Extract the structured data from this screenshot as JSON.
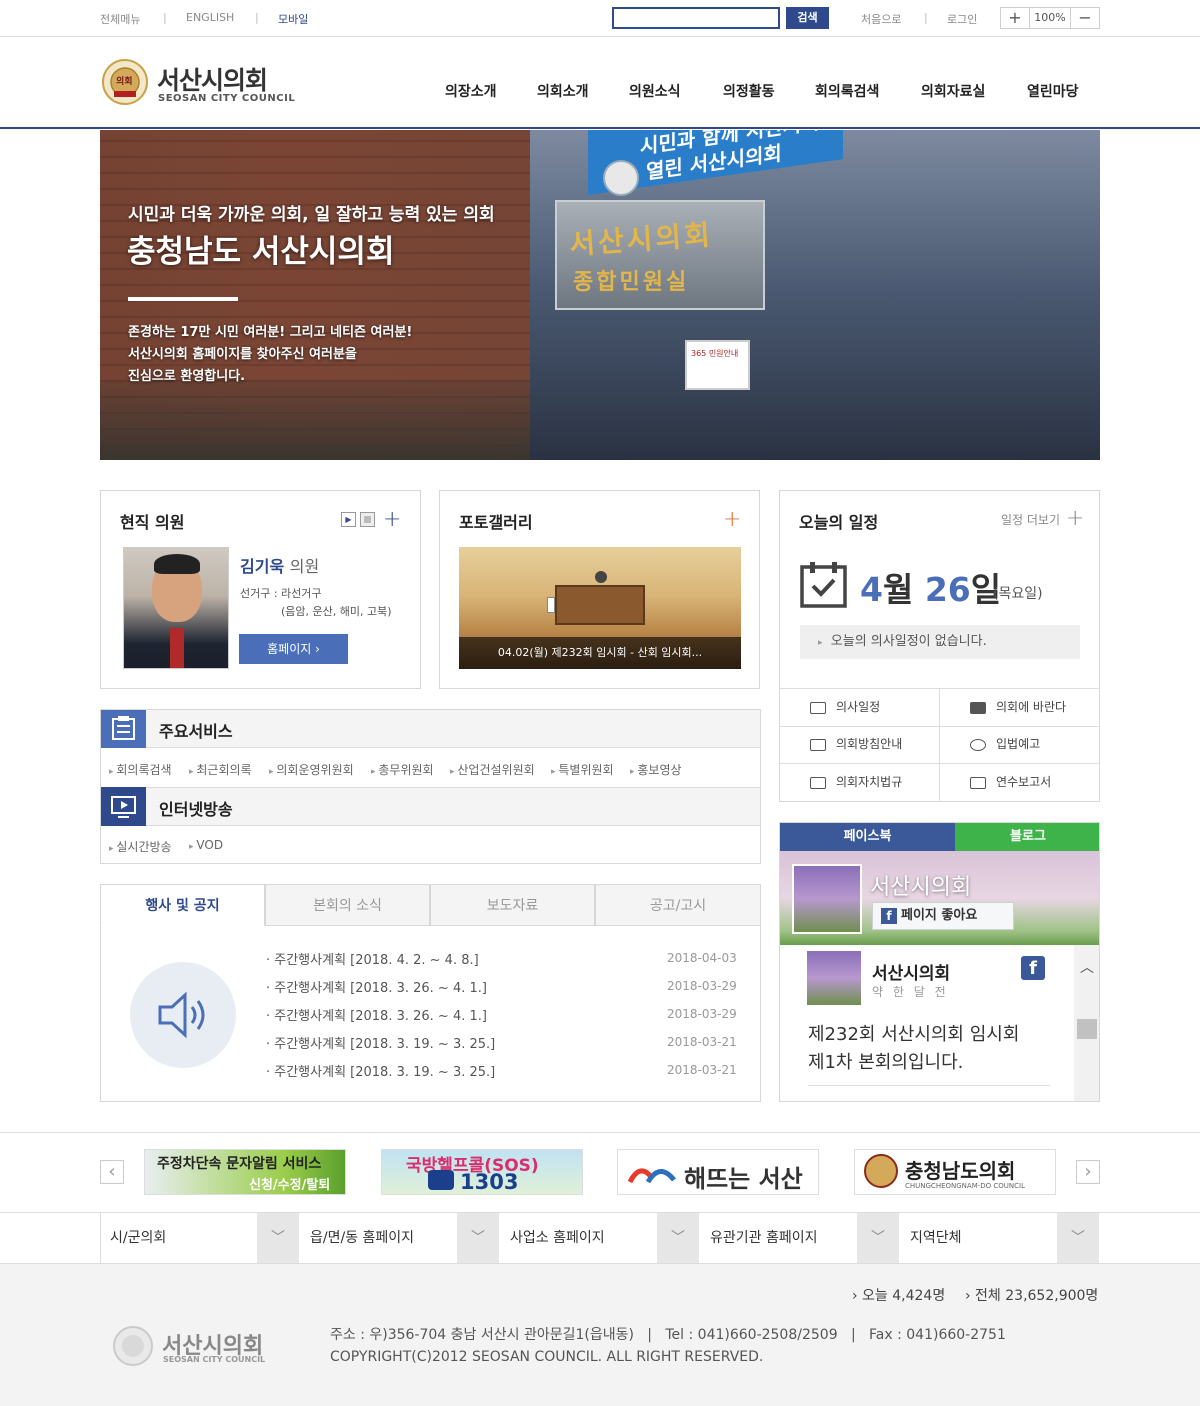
{
  "topbar": {
    "all_menu": "전체메뉴",
    "english": "ENGLISH",
    "mobile": "모바일",
    "search_placeholder": "",
    "search_button": "검색",
    "first": "처음으로",
    "login": "로그인",
    "zoom_in": "+",
    "zoom_level": "100%",
    "zoom_out": "−"
  },
  "brand": {
    "name_ko": "서산시의회",
    "name_en": "SEOSAN CITY COUNCIL",
    "seal_text": "의회"
  },
  "gnb": [
    "의장소개",
    "의회소개",
    "의원소식",
    "의정활동",
    "회의록검색",
    "의회자료실",
    "열린마당"
  ],
  "hero": {
    "sub": "시민과 더욱 가까운 의회, 일 잘하고 능력 있는 의회",
    "title": "충청남도 서산시의회",
    "line1": "존경하는 17만 시민 여러분! 그리고 네티즌 여러분!",
    "line2": "서산시의회 홈페이지를 찾아주신 여러분을",
    "line3": "진심으로 환영합니다.",
    "sign1": "시민과 함께 서산시의회",
    "sign2": "열린 서산시의회",
    "building_sign1": "서산시의회",
    "building_sign2": "종합민원실",
    "door_sign": "365 민원안내"
  },
  "members": {
    "title": "현직 의원",
    "name": "김기욱",
    "role": "의원",
    "district": "선거구 : 라선거구",
    "district_detail": "(음암, 운산, 해미, 고북)",
    "homepage": "홈페이지  ›"
  },
  "gallery": {
    "title": "포토갤러리",
    "caption": "04.02(월) 제232회 임시회 - 산회 임시회..."
  },
  "schedule": {
    "title": "오늘의 일정",
    "more": "일정 더보기",
    "month": "4",
    "month_unit": "월",
    "day": "26",
    "day_unit": "일",
    "weekday": "(목요일)",
    "empty": "오늘의 의사일정이 없습니다.",
    "quick": [
      "의사일정",
      "의회에 바란다",
      "의회방침안내",
      "입법예고",
      "의회자치법규",
      "연수보고서"
    ]
  },
  "services": {
    "title": "주요서비스",
    "items": [
      "회의록검색",
      "최근회의록",
      "의회운영위원회",
      "총무위원회",
      "산업건설위원회",
      "특별위원회",
      "홍보영상"
    ]
  },
  "broadcast": {
    "title": "인터넷방송",
    "items": [
      "실시간방송",
      "VOD"
    ]
  },
  "notices": {
    "tabs": [
      "행사 및 공지",
      "본회의 소식",
      "보도자료",
      "공고/고시"
    ],
    "rows": [
      {
        "title": "· 주간행사계획 [2018. 4. 2. ~ 4. 8.]",
        "date": "2018-04-03"
      },
      {
        "title": "· 주간행사계획 [2018. 3. 26. ~ 4. 1.]",
        "date": "2018-03-29"
      },
      {
        "title": "· 주간행사계획 [2018. 3. 26. ~ 4. 1.]",
        "date": "2018-03-29"
      },
      {
        "title": "· 주간행사계획 [2018. 3. 19. ~ 3. 25.]",
        "date": "2018-03-21"
      },
      {
        "title": "· 주간행사계획 [2018. 3. 19. ~ 3. 25.]",
        "date": "2018-03-21"
      }
    ]
  },
  "sns": {
    "facebook_tab": "페이스북",
    "blog_tab": "블로그",
    "page_name": "서산시의회",
    "like_button": "페이지 좋아요",
    "post_author": "서산시의회",
    "post_time": "약 한 달 전",
    "post_text1": "제232회 서산시의회 임시회",
    "post_text2": "제1차 본회의입니다.",
    "fb_glyph": "f"
  },
  "banners": {
    "prev": "‹",
    "next": "›",
    "b1_line1": "주정차단속 문자알림 서비스",
    "b1_line2": "신청/수정/탈퇴",
    "b2_line1": "국방헬프콜(SOS)",
    "b2_line2": "1303",
    "b3": "해뜨는 서산",
    "b4_ko": "충청남도의회",
    "b4_en": "CHUNGCHEONGNAM-DO COUNCIL"
  },
  "family": [
    "시/군의회",
    "읍/면/동 홈페이지",
    "사업소 홈페이지",
    "유관기관 홈페이지",
    "지역단체"
  ],
  "footer": {
    "today": "› 오늘 4,424명",
    "total": "› 전체 23,652,900명",
    "address": "주소 : 우)356-704 충남 서산시 관아문길1(읍내동)   |   Tel : 041)660-2508/2509   |   Fax : 041)660-2751",
    "copyright": "COPYRIGHT(C)2012 SEOSAN COUNCIL. ALL RIGHT RESERVED."
  },
  "colors": {
    "brand": "#2e4a8c",
    "accent": "#4a6fb8",
    "orange": "#ea6a2c",
    "facebook": "#3b5998",
    "blog": "#3db34a"
  }
}
